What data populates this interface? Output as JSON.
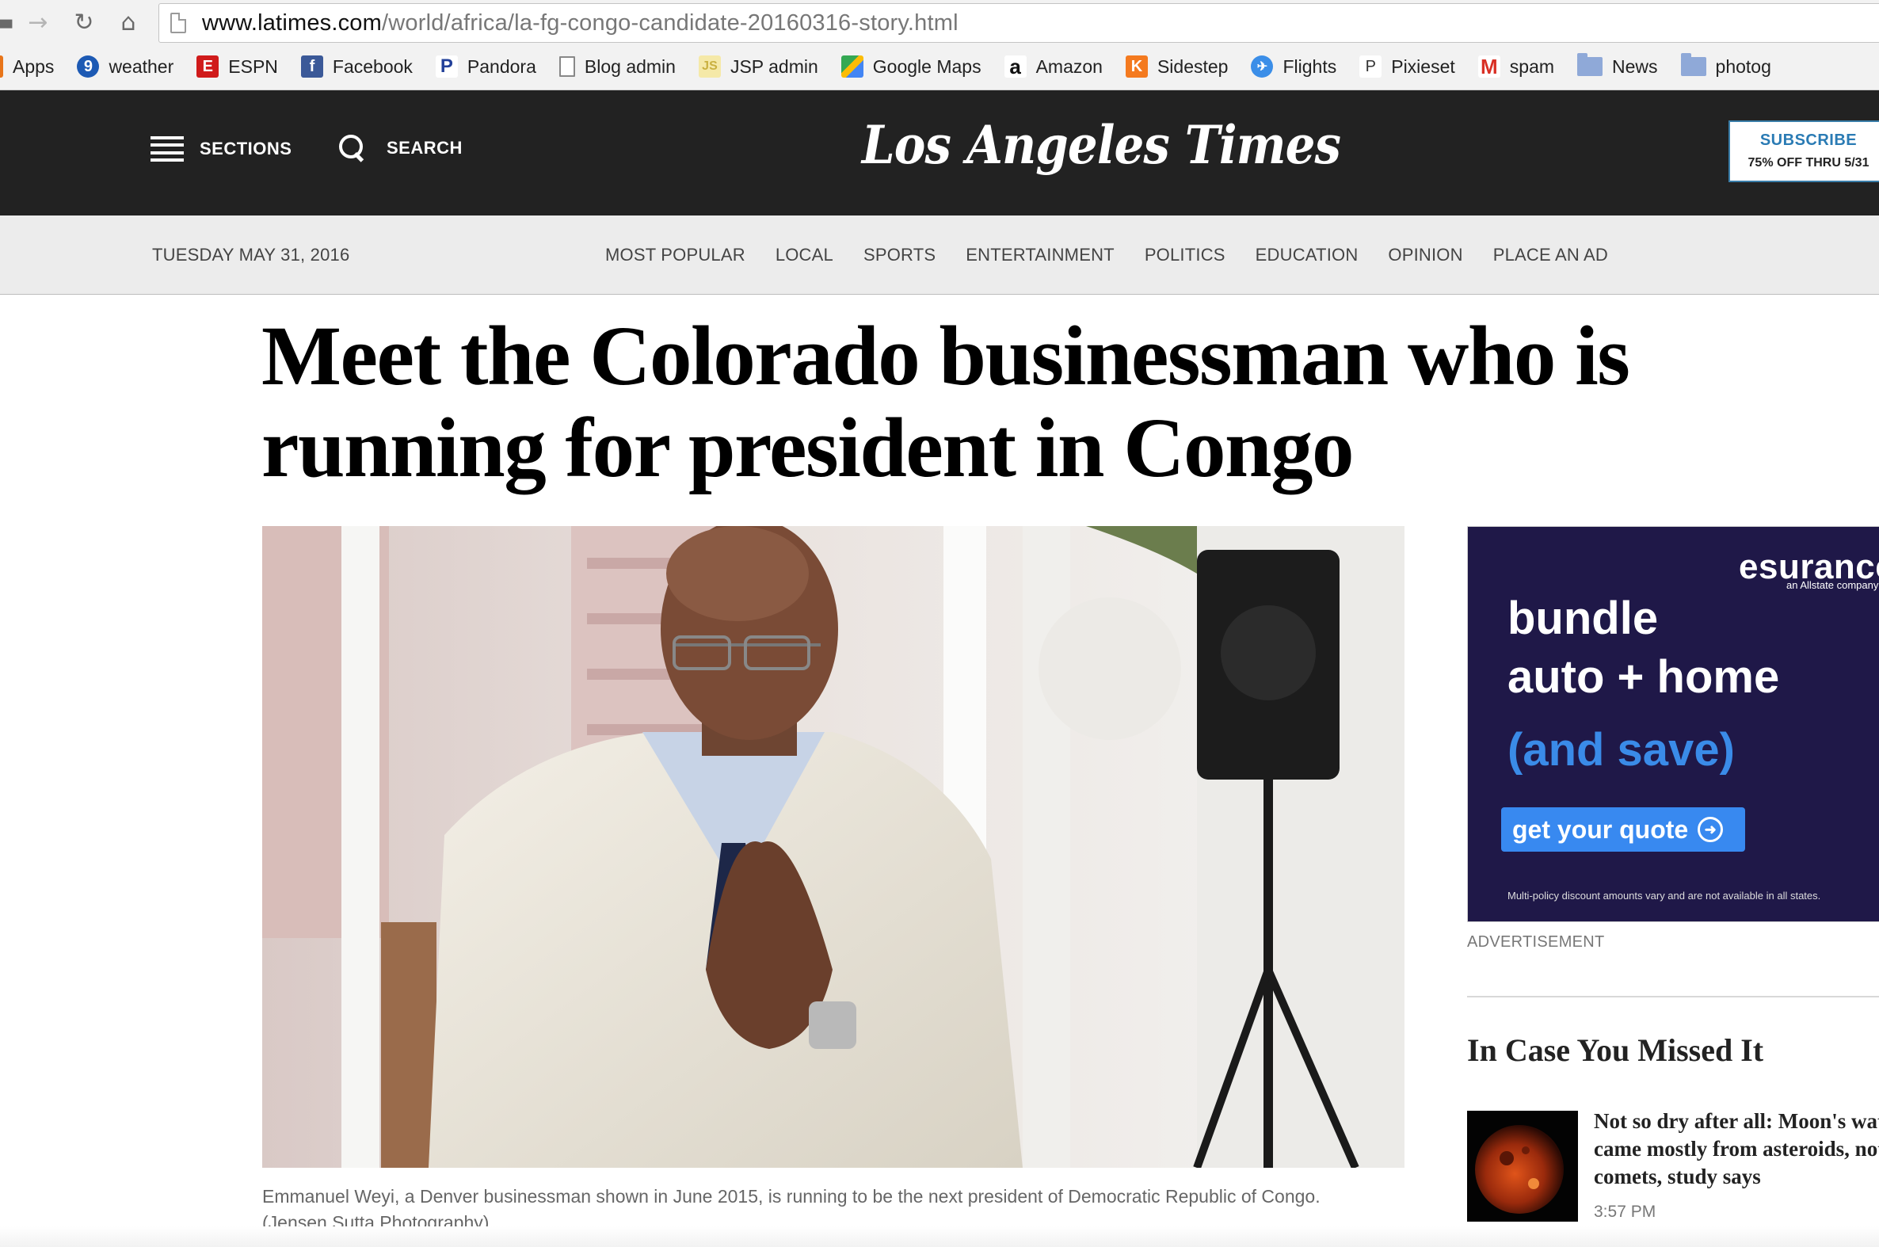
{
  "browser": {
    "url_host": "www.latimes.com",
    "url_path": "/world/africa/la-fg-congo-candidate-20160316-story.html",
    "bookmarks": [
      {
        "label": "Apps",
        "icon": "apps-grid-icon"
      },
      {
        "label": "weather",
        "icon": "weather-9-icon"
      },
      {
        "label": "ESPN",
        "icon": "espn-icon"
      },
      {
        "label": "Facebook",
        "icon": "facebook-icon"
      },
      {
        "label": "Pandora",
        "icon": "pandora-icon"
      },
      {
        "label": "Blog admin",
        "icon": "page-icon"
      },
      {
        "label": "JSP admin",
        "icon": "js-icon"
      },
      {
        "label": "Google Maps",
        "icon": "google-maps-icon"
      },
      {
        "label": "Amazon",
        "icon": "amazon-icon"
      },
      {
        "label": "Sidestep",
        "icon": "sidestep-icon"
      },
      {
        "label": "Flights",
        "icon": "flights-icon"
      },
      {
        "label": "Pixieset",
        "icon": "pixieset-icon"
      },
      {
        "label": "spam",
        "icon": "gmail-icon"
      },
      {
        "label": "News",
        "icon": "folder-icon"
      },
      {
        "label": "photog",
        "icon": "folder-icon"
      }
    ]
  },
  "header": {
    "sections_label": "SECTIONS",
    "search_label": "SEARCH",
    "masthead": "Los Angeles Times",
    "subscribe_label": "SUBSCRIBE",
    "subscribe_offer": "75% OFF THRU 5/31"
  },
  "subnav": {
    "date": "TUESDAY MAY 31, 2016",
    "links": [
      "MOST POPULAR",
      "LOCAL",
      "SPORTS",
      "ENTERTAINMENT",
      "POLITICS",
      "EDUCATION",
      "OPINION",
      "PLACE AN AD"
    ]
  },
  "article": {
    "headline": "Meet the Colorado businessman who is running for president in Congo",
    "caption": "Emmanuel Weyi, a Denver businessman shown in June 2015, is running to be the next president of Democratic Republic of Congo.",
    "credit": "(Jensen Sutta Photography)"
  },
  "ad": {
    "brand": "esurance",
    "brand_sub": "an Allstate company",
    "line1": "bundle",
    "line2": "auto + home",
    "line3": "(and save)",
    "cta": "get your quote",
    "fine_print": "Multi-policy discount amounts vary and are not available in all states.",
    "label": "ADVERTISEMENT"
  },
  "rail": {
    "section_title": "In Case You Missed It",
    "story_title": "Not so dry after all: Moon's water came mostly from asteroids, not comets, study says",
    "story_time": "3:57 PM"
  },
  "colors": {
    "header_bg": "#222222",
    "subnav_bg": "#ececec",
    "subscribe_accent": "#2a7bb4",
    "ad_bg": "#1f1848",
    "ad_accent": "#3889f0"
  }
}
